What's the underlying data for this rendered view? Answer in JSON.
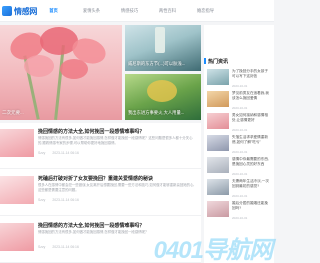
{
  "header": {
    "logo_text": "情感网",
    "nav": [
      {
        "label": "首页",
        "active": true
      },
      {
        "label": "爱情头条",
        "active": false
      },
      {
        "label": "情感技巧",
        "active": false
      },
      {
        "label": "两性百科",
        "active": false
      },
      {
        "label": "婚恋指导",
        "active": false
      }
    ]
  },
  "hero": {
    "big_caption": "二次元要...",
    "small": [
      {
        "caption": "威尼斯的东方节(...)可以肤浅..."
      },
      {
        "caption": "我出东进方事要火,大人用量..."
      }
    ]
  },
  "feed": [
    {
      "title": "挽回情感的方法大全,如何挽回一段感情难事吗？",
      "summary": "情感挽回的方法有很多,如何做才能挽回感情,怎样做才能挽回一段感情呢？这些问题是很多人都十分关心的,跟着情感专家的步骤,可以帮助你更好地挽回感情。",
      "author": "Szzy",
      "date": "2023-11-14 06:16"
    },
    {
      "title": "死磕后打破对折了女友要挽回？重建关爱情感的秘诀",
      "summary": "很多人在感情中都会犯一些错误,女友离开后想要挽回,需要一些方法和技巧,如何做才能够重新赢回她的心,这些都是需要注意的问题。",
      "author": "Szzy",
      "date": "2023-11-14 06:16"
    },
    {
      "title": "挽回情感的方法大全,如何挽回一段感情难事吗？",
      "summary": "情感挽回的方法有很多,如何做才能挽回感情,怎样做才能挽回一段感情呢？",
      "author": "Szzy",
      "date": "2023-11-14 06:16"
    }
  ],
  "sidebar": {
    "title": "热门资讯",
    "items": [
      {
        "text": "为了挽回分手的女孩子可以写下这封信",
        "date": "2023-10-31"
      },
      {
        "text": "梦见前男友在追着我,我该怎么挽回爱情",
        "date": "2023-10-31"
      },
      {
        "text": "男女如何接纳和感情相处,让感情更好",
        "date": "2023-10-31"
      },
      {
        "text": "失落生活求求爱情重新燃,如何了解\"吃亏\"",
        "date": "2023-10-31"
      },
      {
        "text": "感情中你最需要的东西,是挽回心灵的好东西",
        "date": "2023-10-31"
      },
      {
        "text": "夫妻两年生活冷淡,一次回到最初的感觉?",
        "date": "2023-10-31"
      },
      {
        "text": "婚后分居的婚姻还能挽回吗?",
        "date": "2023-10-31"
      }
    ]
  },
  "watermark": "0401导航网"
}
